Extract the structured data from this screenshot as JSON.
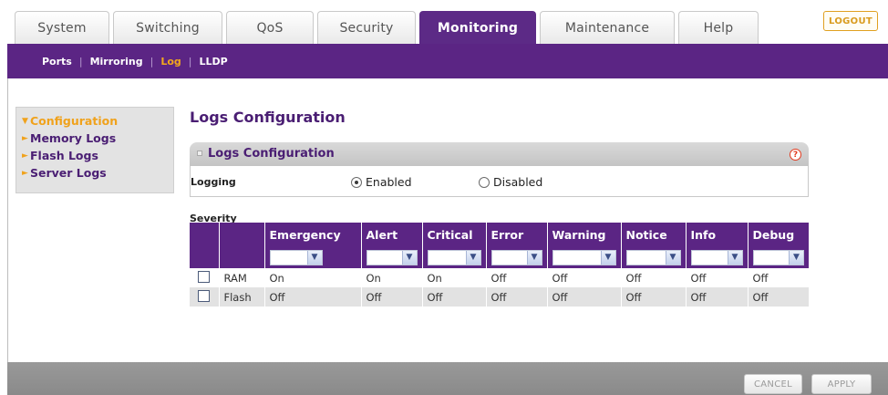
{
  "tabs": [
    {
      "label": "System"
    },
    {
      "label": "Switching"
    },
    {
      "label": "QoS"
    },
    {
      "label": "Security"
    },
    {
      "label": "Monitoring"
    },
    {
      "label": "Maintenance"
    },
    {
      "label": "Help"
    }
  ],
  "active_tab": "Monitoring",
  "logout_label": "LOGOUT",
  "subnav": {
    "items": [
      "Ports",
      "Mirroring",
      "Log",
      "LLDP"
    ],
    "active": "Log"
  },
  "sidebar": {
    "items": [
      {
        "label": "Configuration",
        "active": true
      },
      {
        "label": "Memory Logs",
        "active": false
      },
      {
        "label": "Flash Logs",
        "active": false
      },
      {
        "label": "Server Logs",
        "active": false
      }
    ]
  },
  "main": {
    "page_title": "Logs Configuration",
    "section_title": "Logs Configuration",
    "help_icon": "?",
    "logging_label": "Logging",
    "logging_options": {
      "enabled": "Enabled",
      "disabled": "Disabled",
      "selected": "Enabled"
    },
    "severity_label": "Severity",
    "severity_columns": [
      "Emergency",
      "Alert",
      "Critical",
      "Error",
      "Warning",
      "Notice",
      "Info",
      "Debug"
    ],
    "rows": [
      {
        "name": "RAM",
        "values": [
          "On",
          "On",
          "On",
          "Off",
          "Off",
          "Off",
          "Off",
          "Off"
        ]
      },
      {
        "name": "Flash",
        "values": [
          "Off",
          "Off",
          "Off",
          "Off",
          "Off",
          "Off",
          "Off",
          "Off"
        ]
      }
    ]
  },
  "footer": {
    "cancel": "CANCEL",
    "apply": "APPLY"
  },
  "colors": {
    "brand_purple": "#5b2584",
    "accent_orange": "#f0a21c"
  }
}
